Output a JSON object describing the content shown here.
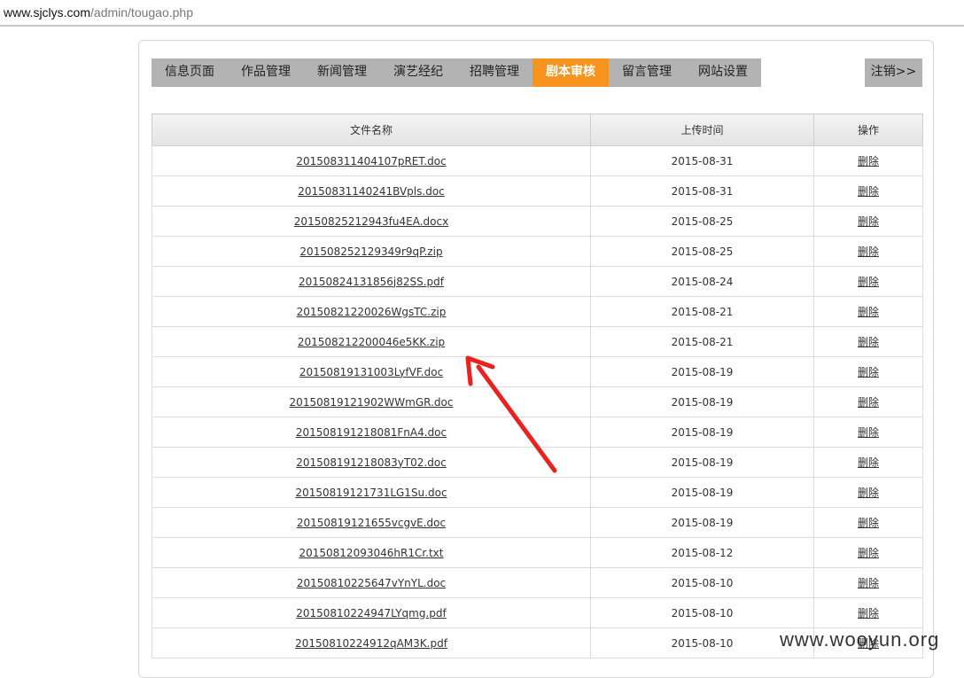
{
  "browser": {
    "url_host": "www.sjclys.com",
    "url_path": "/admin/tougao.php"
  },
  "nav": {
    "tabs": [
      {
        "label": "信息页面",
        "active": false
      },
      {
        "label": "作品管理",
        "active": false
      },
      {
        "label": "新闻管理",
        "active": false
      },
      {
        "label": "演艺经纪",
        "active": false
      },
      {
        "label": "招聘管理",
        "active": false
      },
      {
        "label": "剧本审核",
        "active": true
      },
      {
        "label": "留言管理",
        "active": false
      },
      {
        "label": "网站设置",
        "active": false
      }
    ],
    "logout_label": "注销>>"
  },
  "table": {
    "headers": [
      "文件名称",
      "上传时间",
      "操作"
    ],
    "rows": [
      {
        "file": "20150831140410 7pRET.doc",
        "date": "2015-08-31",
        "action": "删除"
      },
      {
        "file": "20150831140241BVpls.doc",
        "date": "2015-08-31",
        "action": "删除"
      },
      {
        "file": "20150825212943fu4EA.docx",
        "date": "2015-08-25",
        "action": "删除"
      },
      {
        "file": "20150825212934 9r9qP.zip",
        "date": "2015-08-25",
        "action": "删除"
      },
      {
        "file": "20150824131856j82SS.pdf",
        "date": "2015-08-24",
        "action": "删除"
      },
      {
        "file": "20150821220026WgsTC.zip",
        "date": "2015-08-21",
        "action": "删除"
      },
      {
        "file": "20150821220004 6e5KK.zip",
        "date": "2015-08-21",
        "action": "删除"
      },
      {
        "file": "20150819131003LyfVF.doc",
        "date": "2015-08-19",
        "action": "删除"
      },
      {
        "file": "20150819121902WWmGR.doc",
        "date": "2015-08-19",
        "action": "删除"
      },
      {
        "file": "20150819121808 1FnA4.doc",
        "date": "2015-08-19",
        "action": "删除"
      },
      {
        "file": "20150819121808 3yT02.doc",
        "date": "2015-08-19",
        "action": "删除"
      },
      {
        "file": "20150819121731LG1Su.doc",
        "date": "2015-08-19",
        "action": "删除"
      },
      {
        "file": "20150819121655vcgvE.doc",
        "date": "2015-08-19",
        "action": "删除"
      },
      {
        "file": "20150812093046hR1Cr.txt",
        "date": "2015-08-12",
        "action": "删除"
      },
      {
        "file": "20150810225647vYnYL.doc",
        "date": "2015-08-10",
        "action": "删除"
      },
      {
        "file": "20150810224947LYqmg.pdf",
        "date": "2015-08-10",
        "action": "删除"
      },
      {
        "file": "20150810224912qAM3K.pdf",
        "date": "2015-08-10",
        "action": "删除"
      }
    ]
  },
  "annotation": {
    "arrow_color": "#e8231f"
  },
  "watermark": "www.wooyun.org"
}
